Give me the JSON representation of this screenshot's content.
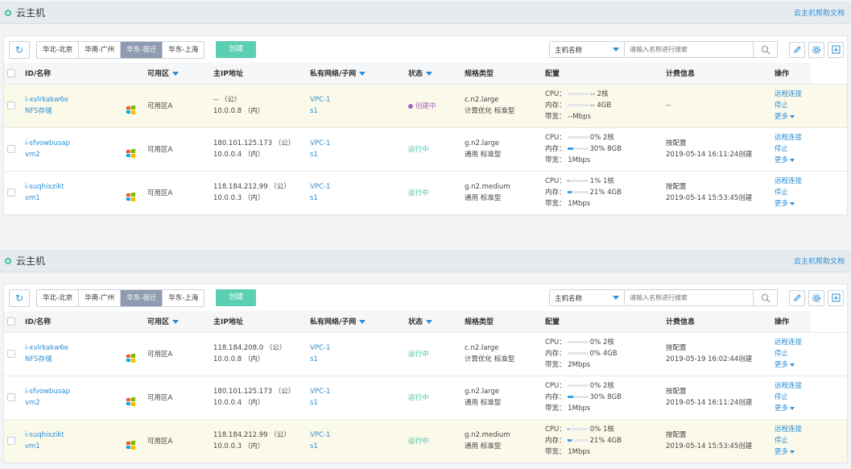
{
  "panels": [
    {
      "title": "云主机",
      "help_link": "云主机帮助文档",
      "regions": [
        {
          "label": "华北-北京",
          "active": false
        },
        {
          "label": "华南-广州",
          "active": false
        },
        {
          "label": "华东-宿迁",
          "active": true
        },
        {
          "label": "华东-上海",
          "active": false
        }
      ],
      "create_label": "创建",
      "filter_select": "主机名称",
      "search_placeholder": "请输入名称进行搜索",
      "columns": [
        "ID/名称",
        "可用区",
        "主IP地址",
        "私有网络/子网",
        "状态",
        "规格类型",
        "配置",
        "计费信息",
        "操作"
      ],
      "rows": [
        {
          "highlight": true,
          "id": "i-xvlrkakw6e",
          "name": "NFS存储",
          "zone": "可用区A",
          "public_ip": "-- （公）",
          "private_ip": "10.0.0.8 （内）",
          "vpc": "VPC-1",
          "subnet": "s1",
          "status": "创建中",
          "status_type": "creating",
          "spec": "c.n2.large",
          "spec_type": "计算优化 标准型",
          "cpu_label": "CPU：",
          "cpu_pct": null,
          "cpu_pct_text": "--",
          "cpu_cores": "2核",
          "mem_label": "内存：",
          "mem_pct": null,
          "mem_pct_text": "--",
          "mem_size": "4GB",
          "bw_label": "带宽：",
          "bandwidth": "--Mbps",
          "billing_mode": "--",
          "billing_time": "",
          "actions": [
            "远程连接",
            "停止",
            "更多"
          ]
        },
        {
          "highlight": false,
          "id": "i-sfvowbusap",
          "name": "vm2",
          "zone": "可用区A",
          "public_ip": "180.101.125.173 （公）",
          "private_ip": "10.0.0.4 （内）",
          "vpc": "VPC-1",
          "subnet": "s1",
          "status": "运行中",
          "status_type": "running",
          "spec": "g.n2.large",
          "spec_type": "通用 标准型",
          "cpu_label": "CPU：",
          "cpu_pct": 0,
          "cpu_pct_text": "0%",
          "cpu_cores": "2核",
          "mem_label": "内存：",
          "mem_pct": 30,
          "mem_pct_text": "30%",
          "mem_size": "8GB",
          "bw_label": "带宽：",
          "bandwidth": "1Mbps",
          "billing_mode": "按配置",
          "billing_time": "2019-05-14 16:11:24创建",
          "actions": [
            "远程连接",
            "停止",
            "更多"
          ]
        },
        {
          "highlight": false,
          "id": "i-suqhixzikt",
          "name": "vm1",
          "zone": "可用区A",
          "public_ip": "118.184.212.99 （公）",
          "private_ip": "10.0.0.3 （内）",
          "vpc": "VPC-1",
          "subnet": "s1",
          "status": "运行中",
          "status_type": "running",
          "spec": "g.n2.medium",
          "spec_type": "通用 标准型",
          "cpu_label": "CPU：",
          "cpu_pct": 1,
          "cpu_pct_text": "1%",
          "cpu_cores": "1核",
          "mem_label": "内存：",
          "mem_pct": 21,
          "mem_pct_text": "21%",
          "mem_size": "4GB",
          "bw_label": "带宽：",
          "bandwidth": "1Mbps",
          "billing_mode": "按配置",
          "billing_time": "2019-05-14 15:53:45创建",
          "actions": [
            "远程连接",
            "停止",
            "更多"
          ]
        }
      ]
    },
    {
      "title": "云主机",
      "help_link": "云主机帮助文档",
      "regions": [
        {
          "label": "华北-北京",
          "active": false
        },
        {
          "label": "华南-广州",
          "active": false
        },
        {
          "label": "华东-宿迁",
          "active": true
        },
        {
          "label": "华东-上海",
          "active": false
        }
      ],
      "create_label": "创建",
      "filter_select": "主机名称",
      "search_placeholder": "请输入名称进行搜索",
      "columns": [
        "ID/名称",
        "可用区",
        "主IP地址",
        "私有网络/子网",
        "状态",
        "规格类型",
        "配置",
        "计费信息",
        "操作"
      ],
      "rows": [
        {
          "highlight": false,
          "id": "i-xvlrkakw6e",
          "name": "NFS存储",
          "zone": "可用区A",
          "public_ip": "118.184.208.0 （公）",
          "private_ip": "10.0.0.8 （内）",
          "vpc": "VPC-1",
          "subnet": "s1",
          "status": "运行中",
          "status_type": "running",
          "spec": "c.n2.large",
          "spec_type": "计算优化 标准型",
          "cpu_label": "CPU：",
          "cpu_pct": 0,
          "cpu_pct_text": "0%",
          "cpu_cores": "2核",
          "mem_label": "内存：",
          "mem_pct": 0,
          "mem_pct_text": "0%",
          "mem_size": "4GB",
          "bw_label": "带宽：",
          "bandwidth": "2Mbps",
          "billing_mode": "按配置",
          "billing_time": "2019-05-19 16:02:44创建",
          "actions": [
            "远程连接",
            "停止",
            "更多"
          ]
        },
        {
          "highlight": false,
          "id": "i-sfvowbusap",
          "name": "vm2",
          "zone": "可用区A",
          "public_ip": "180.101.125.173 （公）",
          "private_ip": "10.0.0.4 （内）",
          "vpc": "VPC-1",
          "subnet": "s1",
          "status": "运行中",
          "status_type": "running",
          "spec": "g.n2.large",
          "spec_type": "通用 标准型",
          "cpu_label": "CPU：",
          "cpu_pct": 0,
          "cpu_pct_text": "0%",
          "cpu_cores": "2核",
          "mem_label": "内存：",
          "mem_pct": 30,
          "mem_pct_text": "30%",
          "mem_size": "8GB",
          "bw_label": "带宽：",
          "bandwidth": "1Mbps",
          "billing_mode": "按配置",
          "billing_time": "2019-05-14 16:11:24创建",
          "actions": [
            "远程连接",
            "停止",
            "更多"
          ]
        },
        {
          "highlight": true,
          "id": "i-suqhixzikt",
          "name": "vm1",
          "zone": "可用区A",
          "public_ip": "118.184.212.99 （公）",
          "private_ip": "10.0.0.3 （内）",
          "vpc": "VPC-1",
          "subnet": "s1",
          "status": "运行中",
          "status_type": "running",
          "spec": "g.n2.medium",
          "spec_type": "通用 标准型",
          "cpu_label": "CPU：",
          "cpu_pct": 1,
          "cpu_pct_text": "0%",
          "cpu_cores": "1核",
          "mem_label": "内存：",
          "mem_pct": 21,
          "mem_pct_text": "21%",
          "mem_size": "4GB",
          "bw_label": "带宽：",
          "bandwidth": "1Mbps",
          "billing_mode": "按配置",
          "billing_time": "2019-05-14 15:53:45创建",
          "actions": [
            "远程连接",
            "停止",
            "更多"
          ]
        }
      ]
    }
  ],
  "colors": {
    "accent": "#2a8fd6",
    "running": "#3cc4a6",
    "creating": "#a764c4",
    "create_button": "#5bcfb2",
    "active_region": "#8e9bb0",
    "highlight_row": "#fbf9ea"
  },
  "icons": {
    "panel": "ring-icon",
    "refresh": "refresh-icon",
    "search": "search-icon",
    "edit": "pencil-icon",
    "settings": "gear-icon",
    "download": "download-icon",
    "os": "windows-icon"
  }
}
